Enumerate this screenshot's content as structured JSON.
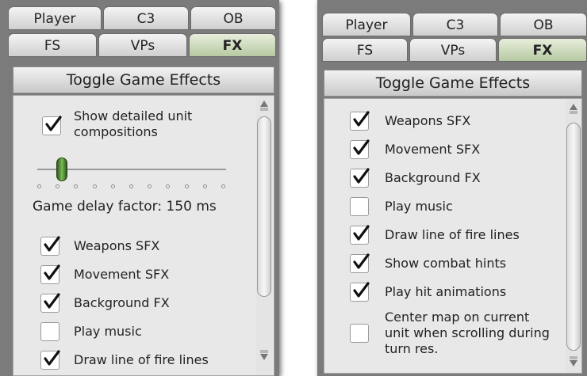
{
  "tabs_top": [
    "Player",
    "C3",
    "OB"
  ],
  "tabs_bottom": [
    "FS",
    "VPs",
    "FX"
  ],
  "toggle_button": "Toggle Game Effects",
  "left": {
    "unit_comp_label": "Show detailed unit compositions",
    "unit_comp_checked": true,
    "slider_level": 0.1,
    "slider_ticks": 11,
    "delay_label": "Game delay factor: 150 ms",
    "items": [
      {
        "label": "Weapons SFX",
        "checked": true
      },
      {
        "label": "Movement SFX",
        "checked": true
      },
      {
        "label": "Background FX",
        "checked": true
      },
      {
        "label": "Play music",
        "checked": false
      },
      {
        "label": "Draw line of fire lines",
        "checked": true
      }
    ]
  },
  "right": {
    "items": [
      {
        "label": "Weapons SFX",
        "checked": true
      },
      {
        "label": "Movement SFX",
        "checked": true
      },
      {
        "label": "Background FX",
        "checked": true
      },
      {
        "label": "Play music",
        "checked": false
      },
      {
        "label": "Draw line of fire lines",
        "checked": true
      },
      {
        "label": "Show combat hints",
        "checked": true
      },
      {
        "label": "Play hit animations",
        "checked": true
      }
    ],
    "center_map_lines": [
      "Center map on current",
      "unit when scrolling during",
      "turn res."
    ],
    "center_map_checked": false
  },
  "colors": {
    "active_tab": "#b7c9a3",
    "knob": "#5a9a3a"
  }
}
